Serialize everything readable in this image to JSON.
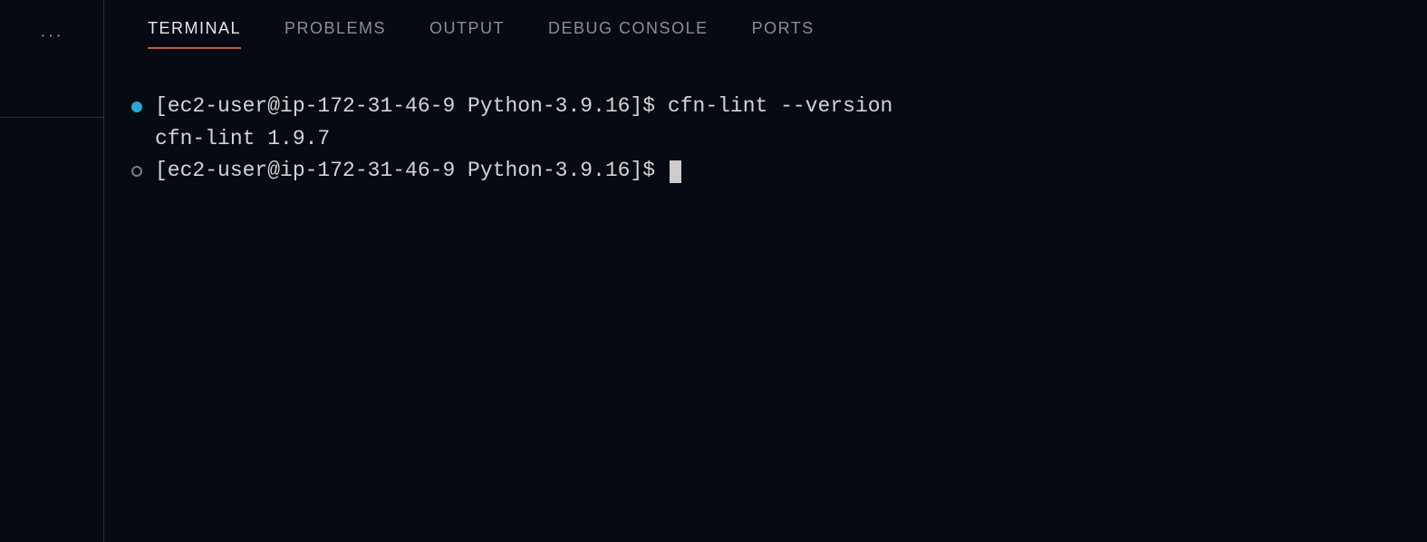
{
  "sidebar": {
    "ellipsis": "···"
  },
  "tabs": [
    {
      "label": "TERMINAL",
      "active": true
    },
    {
      "label": "PROBLEMS",
      "active": false
    },
    {
      "label": "OUTPUT",
      "active": false
    },
    {
      "label": "DEBUG CONSOLE",
      "active": false
    },
    {
      "label": "PORTS",
      "active": false
    }
  ],
  "terminal": {
    "lines": [
      {
        "marker": "filled",
        "prompt": "[ec2-user@ip-172-31-46-9 Python-3.9.16]$ ",
        "command": "cfn-lint --version"
      },
      {
        "output": "cfn-lint 1.9.7"
      },
      {
        "marker": "hollow",
        "prompt": "[ec2-user@ip-172-31-46-9 Python-3.9.16]$ ",
        "cursor": true
      }
    ]
  }
}
